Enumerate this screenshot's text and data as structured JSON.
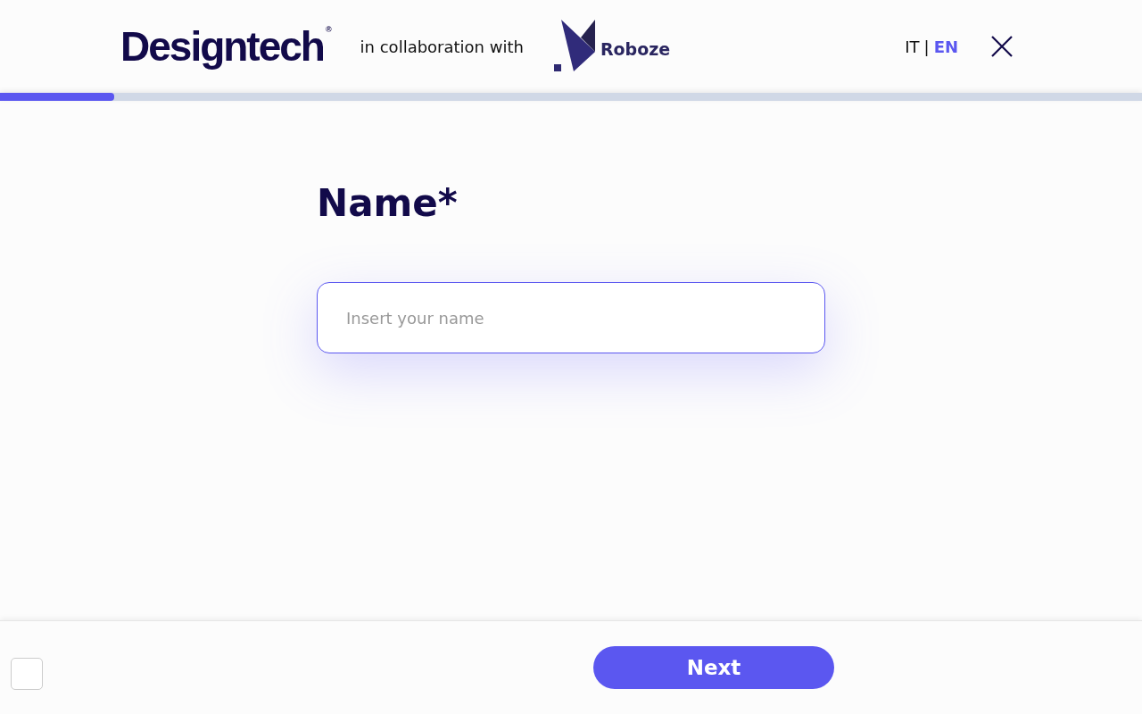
{
  "header": {
    "brand": "Designtech",
    "brand_mark": "®",
    "collab_text": "in collaboration with",
    "partner": "Roboze",
    "languages": [
      {
        "code": "IT",
        "selected": false
      },
      {
        "code": "EN",
        "selected": true
      }
    ],
    "language_separator": "|"
  },
  "progress": {
    "level": 0.1
  },
  "question": {
    "label": "Name*",
    "placeholder": "Insert your name"
  },
  "footer": {
    "next_button": "Next"
  }
}
